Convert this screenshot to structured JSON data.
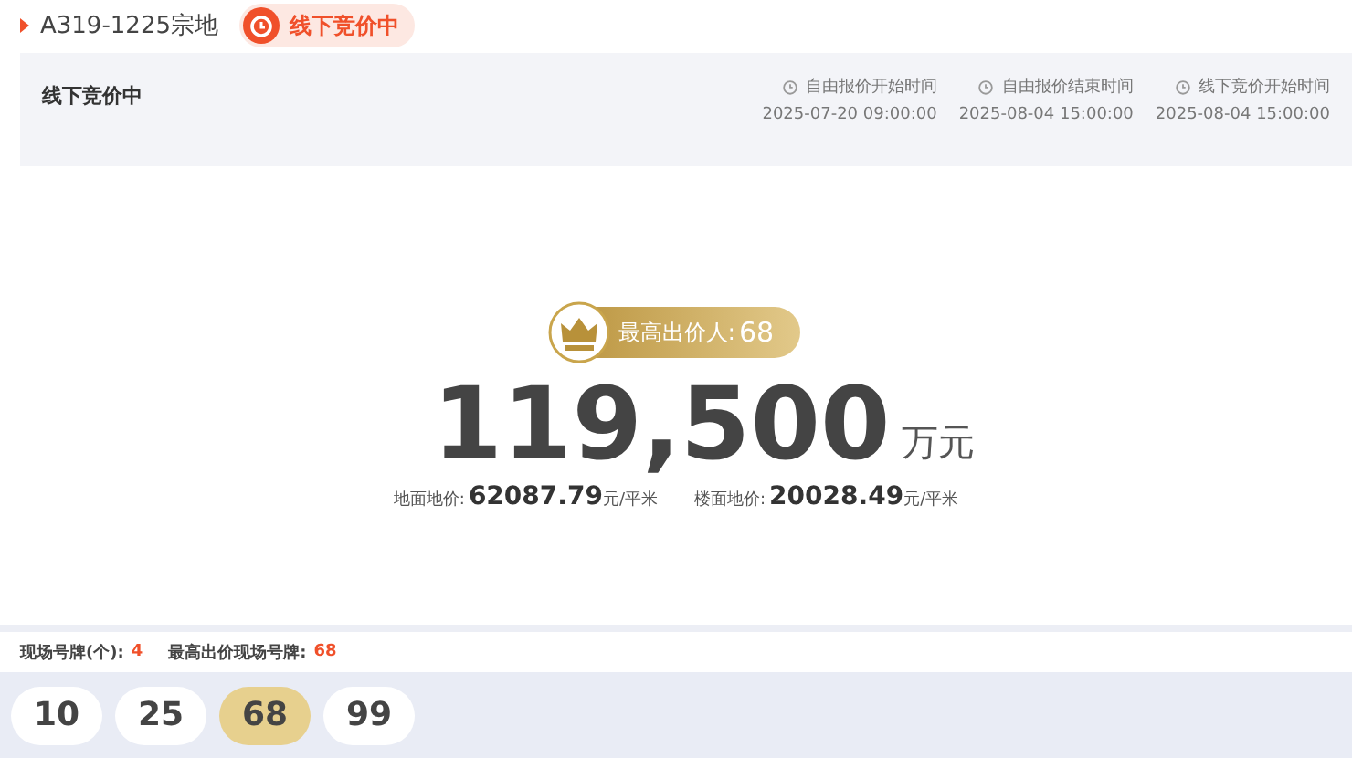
{
  "header": {
    "title": "A319-1225宗地",
    "status_badge": "线下竞价中"
  },
  "info_panel": {
    "title": "线下竞价中",
    "times": [
      {
        "label": "自由报价开始时间",
        "value": "2025-07-20 09:00:00"
      },
      {
        "label": "自由报价结束时间",
        "value": "2025-08-04 15:00:00"
      },
      {
        "label": "线下竞价开始时间",
        "value": "2025-08-04 15:00:00"
      }
    ]
  },
  "top_bidder": {
    "label": "最高出价人:",
    "number": "68"
  },
  "price": {
    "amount": "119,500",
    "unit": "万元"
  },
  "unit_prices": [
    {
      "label": "地面地价:",
      "value": "62087.79",
      "unit": "元/平米"
    },
    {
      "label": "楼面地价:",
      "value": "20028.49",
      "unit": "元/平米"
    }
  ],
  "summary": [
    {
      "label": "现场号牌(个):",
      "value": "4"
    },
    {
      "label": "最高出价现场号牌:",
      "value": "68"
    }
  ],
  "paddles": [
    {
      "number": "10",
      "selected": false
    },
    {
      "number": "25",
      "selected": false
    },
    {
      "number": "68",
      "selected": true
    },
    {
      "number": "99",
      "selected": false
    }
  ]
}
